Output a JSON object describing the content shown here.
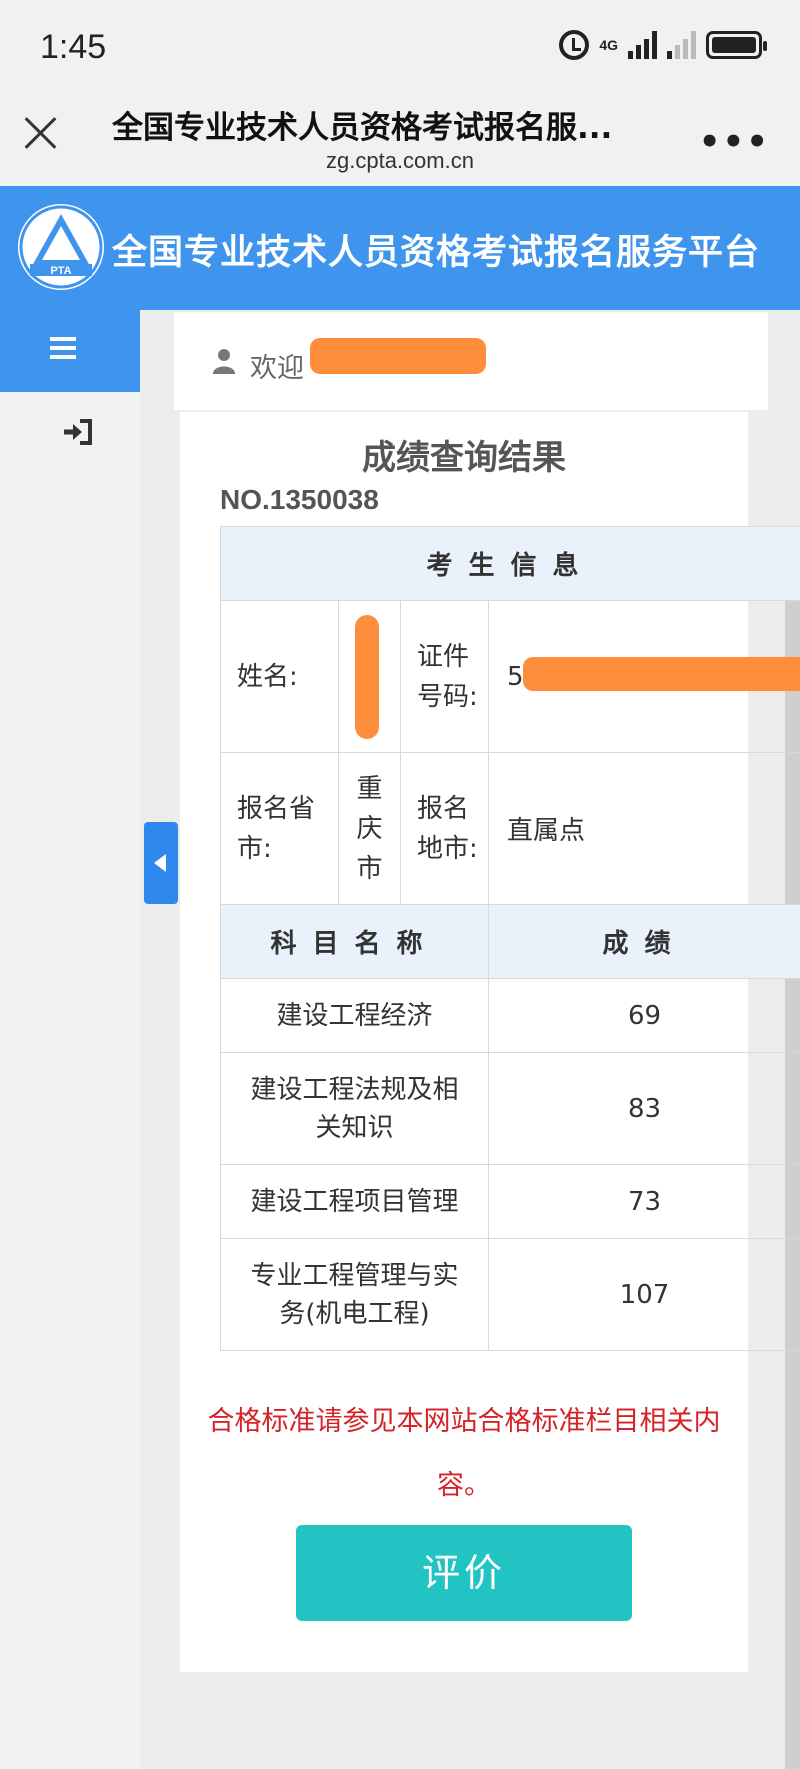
{
  "status_bar": {
    "time": "1:45",
    "network": "4G"
  },
  "browser": {
    "title": "全国专业技术人员资格考试报名服...",
    "url": "zg.cpta.com.cn"
  },
  "site": {
    "logo_text": "PTA",
    "title": "全国专业技术人员资格考试报名服务平台"
  },
  "welcome": {
    "prefix": "欢迎"
  },
  "result": {
    "title": "成绩查询结果",
    "record_no": "NO.1350038",
    "candidate_header": "考生信息",
    "name_label": "姓名:",
    "id_label": "证件号码:",
    "id_value_prefix": "5",
    "province_label": "报名省市:",
    "province_value": "重庆市",
    "city_label": "报名地市:",
    "city_value": "直属点",
    "subject_header": "科目名称",
    "score_header": "成绩",
    "scores": [
      {
        "subject": "建设工程经济",
        "score": "69"
      },
      {
        "subject": "建设工程法规及相关知识",
        "score": "83"
      },
      {
        "subject": "建设工程项目管理",
        "score": "73"
      },
      {
        "subject": "专业工程管理与实务(机电工程)",
        "score": "107"
      }
    ],
    "notice": "合格标准请参见本网站合格标准栏目相关内容。",
    "evaluate_button": "评价"
  },
  "colors": {
    "primary_blue": "#3f95ee",
    "button_teal": "#22c3c3",
    "notice_red": "#d4242a",
    "redaction_orange": "#ff8e3c"
  },
  "icons": [
    "close-icon",
    "more-icon",
    "menu-icon",
    "login-icon",
    "user-icon",
    "caret-left-icon"
  ]
}
